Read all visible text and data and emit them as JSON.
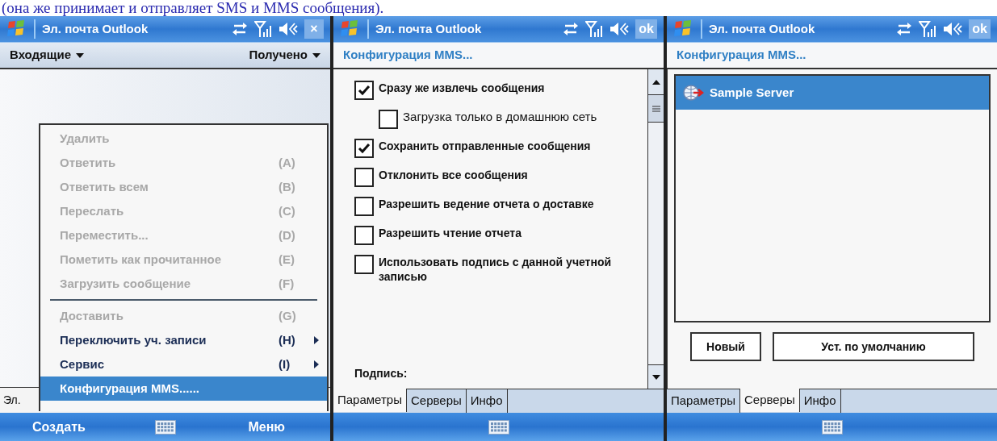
{
  "caption": "(она же принимает и отправляет SMS и MMS сообщения).",
  "screens": [
    {
      "kind": "inbox",
      "title": "Эл. почта Outlook",
      "title_action": "×",
      "folder": "Входящие",
      "sort": "Получено",
      "status_text": "Эл.",
      "menu": [
        {
          "kind": "item",
          "label": "Удалить",
          "disabled": true,
          "submenu": false,
          "selected": false
        },
        {
          "kind": "item",
          "label": "Ответить",
          "shortcut": "(A)",
          "disabled": true,
          "submenu": false,
          "selected": false
        },
        {
          "kind": "item",
          "label": "Ответить всем",
          "shortcut": "(B)",
          "disabled": true,
          "submenu": false,
          "selected": false
        },
        {
          "kind": "item",
          "label": "Переслать",
          "shortcut": "(C)",
          "disabled": true,
          "submenu": false,
          "selected": false
        },
        {
          "kind": "item",
          "label": "Переместить...",
          "shortcut": "(D)",
          "disabled": true,
          "submenu": false,
          "selected": false
        },
        {
          "kind": "item",
          "label": "Пометить как прочитанное",
          "shortcut": "(E)",
          "disabled": true,
          "submenu": false,
          "selected": false
        },
        {
          "kind": "item",
          "label": "Загрузить сообщение",
          "shortcut": "(F)",
          "disabled": true,
          "submenu": false,
          "selected": false
        },
        {
          "kind": "separator"
        },
        {
          "kind": "item",
          "label": "Доставить",
          "shortcut": "(G)",
          "disabled": true,
          "submenu": false,
          "selected": false
        },
        {
          "kind": "item",
          "label": "Переключить уч. записи",
          "shortcut": "(H)",
          "disabled": false,
          "submenu": true,
          "selected": false
        },
        {
          "kind": "item",
          "label": "Сервис",
          "shortcut": "(I)",
          "disabled": false,
          "submenu": true,
          "selected": false
        },
        {
          "kind": "item",
          "label": "Конфигурация MMS......",
          "disabled": false,
          "submenu": false,
          "selected": true
        }
      ],
      "left_softkey": "Создать",
      "right_softkey": "Меню"
    },
    {
      "kind": "options",
      "title": "Эл. почта Outlook",
      "title_action": "ok",
      "heading": "Конфигурация MMS...",
      "options": [
        {
          "label": "Сразу же извлечь сообщения",
          "checked": true,
          "children": [
            {
              "label": "Загрузка только в домашнюю сеть",
              "checked": false
            }
          ]
        },
        {
          "label": "Сохранить отправленные сообщения",
          "checked": true
        },
        {
          "label": "Отклонить все сообщения",
          "checked": false
        },
        {
          "label": "Разрешить ведение отчета о доставке",
          "checked": false
        },
        {
          "label": "Разрешить чтение отчета",
          "checked": false
        },
        {
          "label": "Использовать подпись с данной учетной записью",
          "checked": false
        }
      ],
      "footer_label": "Подпись:",
      "tabs": [
        {
          "label": "Параметры",
          "selected": true
        },
        {
          "label": "Серверы",
          "selected": false
        },
        {
          "label": "Инфо",
          "selected": false
        }
      ]
    },
    {
      "kind": "servers",
      "title": "Эл. почта Outlook",
      "title_action": "ok",
      "heading": "Конфигурация MMS...",
      "servers": [
        {
          "name": "Sample Server",
          "selected": true
        }
      ],
      "buttons": [
        "Новый",
        "Уст. по умолчанию"
      ],
      "tabs": [
        {
          "label": "Параметры",
          "selected": false
        },
        {
          "label": "Серверы",
          "selected": true
        },
        {
          "label": "Инфо",
          "selected": false
        }
      ]
    }
  ]
}
